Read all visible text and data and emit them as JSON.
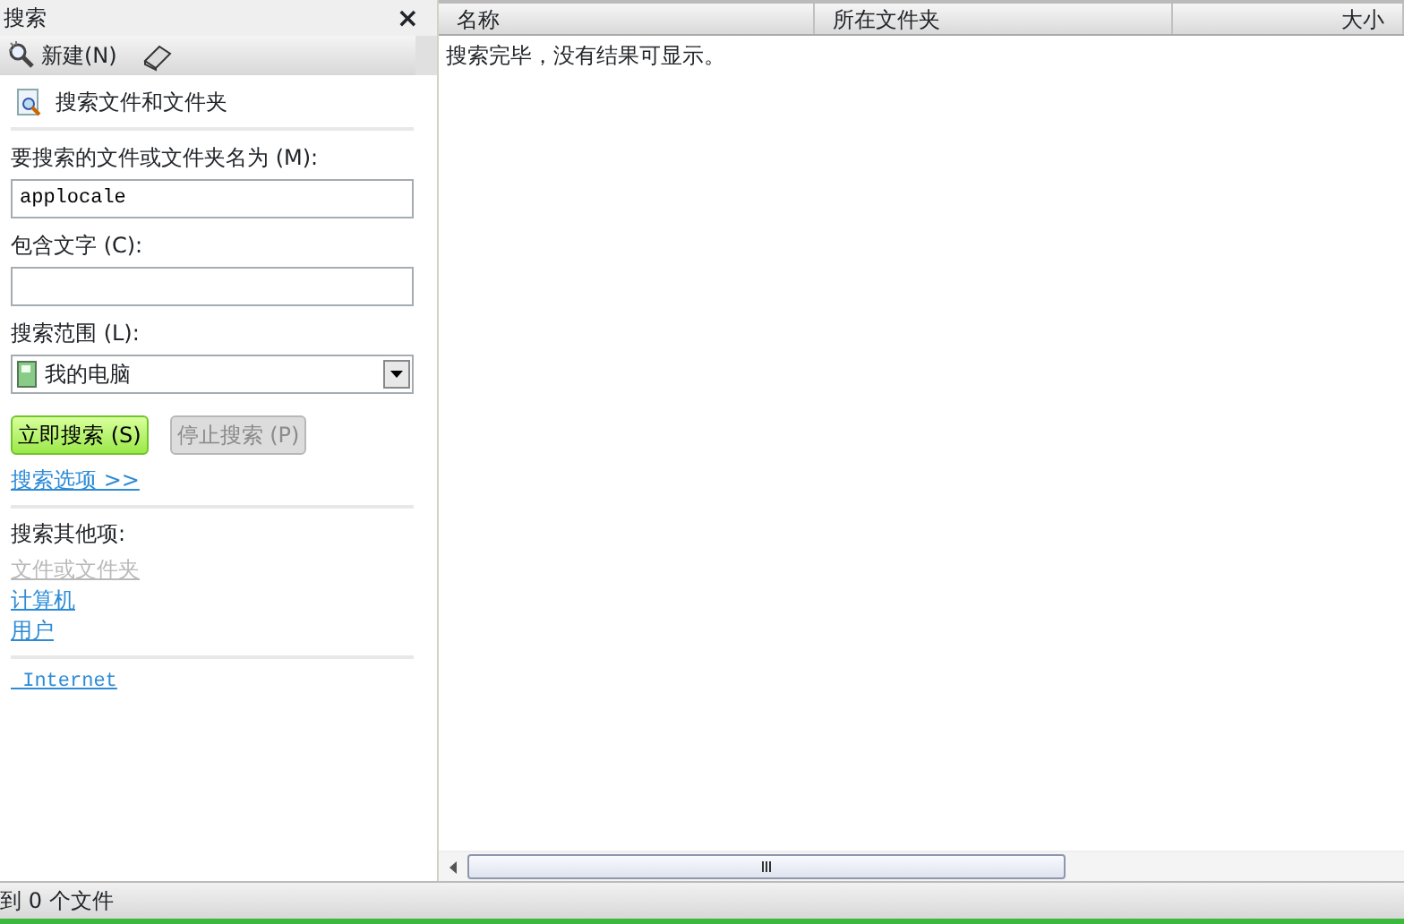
{
  "pane": {
    "title": "搜索",
    "close": "×"
  },
  "toolbar": [
    {
      "kind": "new",
      "label": "新建(N)"
    },
    {
      "kind": "book"
    }
  ],
  "section_title": "搜索文件和文件夹",
  "name_field": {
    "label": "要搜索的文件或文件夹名为 (M):",
    "value": "applocale"
  },
  "text_field": {
    "label": "包含文字 (C):"
  },
  "scope": {
    "label": "搜索范围 (L):",
    "value": "我的电脑"
  },
  "buttons": [
    {
      "label": "立即搜索 (S)",
      "disabled": false
    },
    {
      "label": "停止搜索 (P)",
      "disabled": true
    }
  ],
  "options_link": "搜索选项 >>",
  "other_title": "搜索其他项:",
  "other_links": [
    {
      "label": "文件或文件夹",
      "disabled": true
    },
    {
      "label": "计算机",
      "disabled": false
    },
    {
      "label": "用户",
      "disabled": false
    }
  ],
  "internet_link": " Internet",
  "table": {
    "columns": [
      "名称",
      "所在文件夹",
      "大小"
    ],
    "message": "搜索完毕，没有结果可显示。"
  },
  "status_bar": "到 0 个文件"
}
